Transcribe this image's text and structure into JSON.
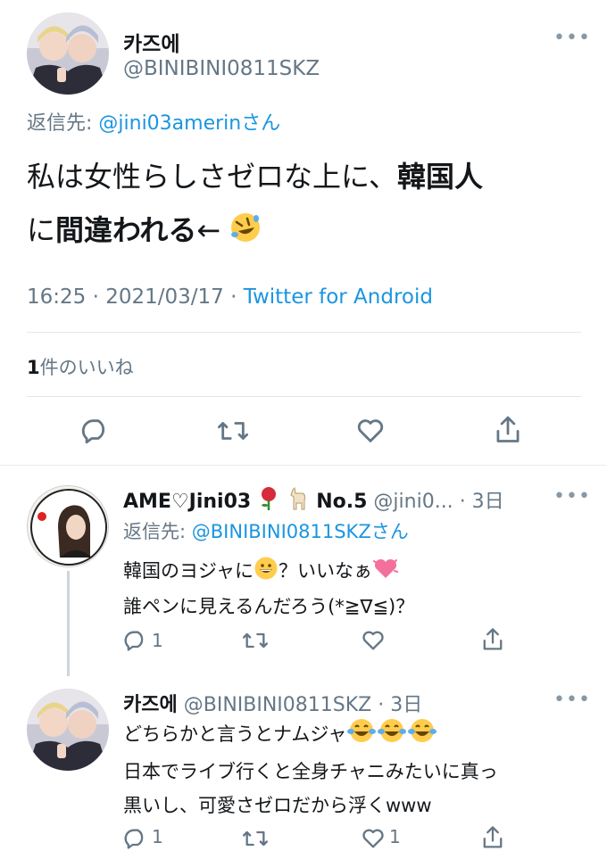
{
  "main_tweet": {
    "display_name": "카즈에",
    "handle": "@BINIBINI0811SKZ",
    "reply_prefix": "返信先: ",
    "reply_to": "@jini03amerinさん",
    "text_line1_a": "私は女性らしさゼロな上に、",
    "text_line1_b": "韓国人",
    "text_line2_a": "に",
    "text_line2_b": "間違われる",
    "text_line2_c": "←",
    "emoji": "rolling-on-floor-laughing",
    "timestamp": "16:25 · 2021/03/17 · ",
    "source": "Twitter for Android",
    "like_count": "1",
    "like_label": "件のいいね"
  },
  "replies": [
    {
      "display_name": "AME♡Jini03",
      "display_name_suffix": "No.5",
      "handle": "@jini0...",
      "time": "· 3日",
      "reply_prefix": "返信先: ",
      "reply_to": "@BINIBINI0811SKZさん",
      "line1_a": "韓国のヨジャに",
      "line1_b": "？いいなぁ",
      "line2": "誰ペンに見えるんだろう(*≧∇≦)？",
      "reply_count": "1",
      "like_count": ""
    },
    {
      "display_name": "카즈에",
      "handle": "@BINIBINI0811SKZ",
      "time": "· 3日",
      "line1": "どちらかと言うとナムジャ",
      "line2": "日本でライブ行くと全身チャニみたいに真っ",
      "line3": "黒いし、可愛さゼロだから浮くwww",
      "reply_count": "1",
      "like_count": "1"
    }
  ],
  "icons": [
    "reply-icon",
    "retweet-icon",
    "like-icon",
    "share-icon",
    "more-icon",
    "rose-emoji",
    "llama-emoji",
    "grinning-emoji",
    "heart-emoji",
    "tears-of-joy-emoji"
  ],
  "colors": {
    "link": "#1b95e0",
    "secondary": "#657786",
    "divider": "#e1e8ed"
  }
}
